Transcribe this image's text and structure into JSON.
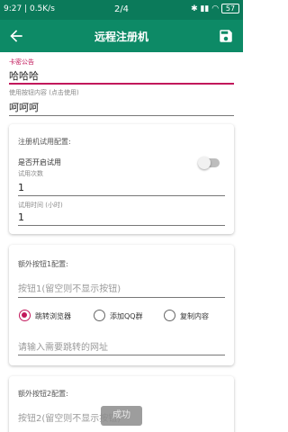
{
  "status_bar": {
    "time_speed": "9:27 | 0.5K/s",
    "page_indicator": "2/4",
    "battery": "57"
  },
  "app_bar": {
    "title": "远程注册机"
  },
  "card_notice": {
    "label": "卡密公告",
    "value": "哈哈哈",
    "helper": "使用按钮内容 (点击使用)",
    "value2": "呵呵呵"
  },
  "trial_card": {
    "title": "注册机试用配置:",
    "toggle_label": "是否开启试用",
    "toggle_on": false,
    "count_label": "试用次数",
    "count_value": "1",
    "time_label": "试用时间 (小时)",
    "time_value": "1"
  },
  "extra_button_1": {
    "title": "额外按钮1配置:",
    "placeholder": "按钮1(留空则不显示按钮)",
    "options": [
      "跳转浏览器",
      "添加QQ群",
      "复制内容"
    ],
    "selected_index": 0,
    "url_placeholder": "请输入需要跳转的网址"
  },
  "extra_button_2": {
    "title": "额外按钮2配置:",
    "placeholder": "按钮2(留空则不显示按钮)"
  },
  "toast": {
    "text": "成功"
  },
  "colors": {
    "status_bar": "#0b7a5a",
    "app_bar": "#0d8a66",
    "accent": "#c2185b"
  }
}
